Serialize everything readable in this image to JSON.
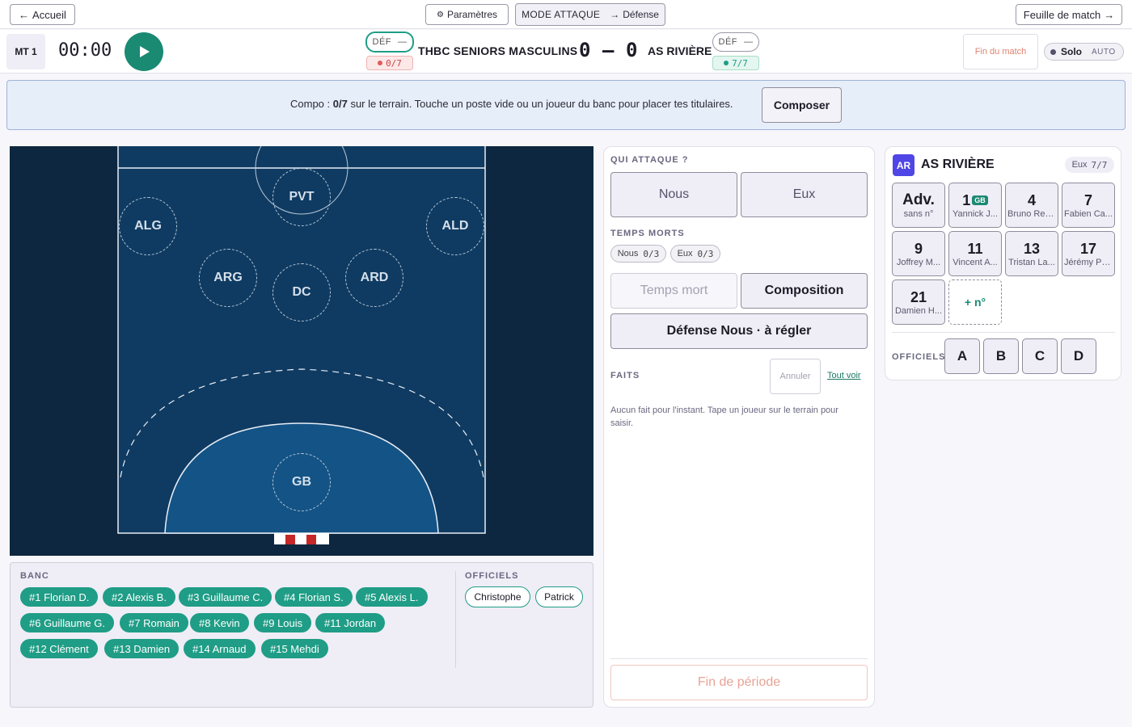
{
  "topbar": {
    "home_label": "Accueil",
    "settings_label": "Paramètres",
    "mode_label": "MODE ATTAQUE",
    "mode_target": "Défense",
    "sheet_label": "Feuille de match"
  },
  "scorebar": {
    "period": "MT 1",
    "clock": "00:00",
    "home": {
      "def_label": "DÉF",
      "count": "0/7",
      "name": "THBC SENIORS MASCULINS",
      "score": "0"
    },
    "away": {
      "def_label": "DÉF",
      "count": "7/7",
      "name": "AS RIVIÈRE",
      "score": "0"
    },
    "score_sep": "–",
    "end_match_label": "Fin du match",
    "solo_label": "Solo",
    "auto_label": "AUTO"
  },
  "banner": {
    "prefix": "Compo : ",
    "count": "0/7",
    "text": " sur le terrain. Touche un poste vide ou un joueur du banc pour placer tes titulaires.",
    "compose_label": "Composer"
  },
  "court": {
    "positions": [
      "PVT",
      "ALG",
      "ALD",
      "ARG",
      "DC",
      "ARD",
      "GB"
    ]
  },
  "bench": {
    "title": "BANC",
    "players": [
      "#1 Florian D.",
      "#2 Alexis B.",
      "#3 Guillaume C.",
      "#4 Florian S.",
      "#5 Alexis L.",
      "#6 Guillaume G.",
      "#7 Romain",
      "#8 Kevin",
      "#9 Louis",
      "#11 Jordan",
      "#12 Clément",
      "#13 Damien",
      "#14 Arnaud",
      "#15 Mehdi"
    ],
    "officials_title": "OFFICIELS",
    "officials": [
      "Christophe",
      "Patrick"
    ]
  },
  "mid": {
    "attack_title": "QUI ATTAQUE ?",
    "us_label": "Nous",
    "them_label": "Eux",
    "timeouts_title": "TEMPS MORTS",
    "to_us_label": "Nous",
    "to_us_count": "0/3",
    "to_them_label": "Eux",
    "to_them_count": "0/3",
    "timeout_btn": "Temps mort",
    "composition_btn": "Composition",
    "defense_btn": "Défense Nous · à régler",
    "facts_title": "FAITS",
    "undo_label": "Annuler",
    "see_all_label": "Tout voir",
    "empty_facts": "Aucun fait pour l'instant. Tape un joueur sur le terrain pour saisir.",
    "end_period_label": "Fin de période"
  },
  "right": {
    "badge": "AR",
    "team": "AS RIVIÈRE",
    "count_label": "Eux",
    "count": "7/7",
    "players": [
      {
        "num": "Adv.",
        "name": "sans n°"
      },
      {
        "num": "1",
        "gk": "GB",
        "name": "Yannick J..."
      },
      {
        "num": "4",
        "name": "Bruno Rey..."
      },
      {
        "num": "7",
        "name": "Fabien Ca..."
      },
      {
        "num": "9",
        "name": "Joffrey M..."
      },
      {
        "num": "11",
        "name": "Vincent A..."
      },
      {
        "num": "13",
        "name": "Tristan La..."
      },
      {
        "num": "17",
        "name": "Jérémy Pa..."
      },
      {
        "num": "21",
        "name": "Damien H..."
      }
    ],
    "add_label": "+ n°",
    "officials_title": "OFFICIELS",
    "officials": [
      "A",
      "B",
      "C",
      "D"
    ]
  },
  "colors": {
    "accent": "#1f9d86",
    "danger": "#e05a5a",
    "court": "#0d2740",
    "brand": "#4f46e5"
  }
}
